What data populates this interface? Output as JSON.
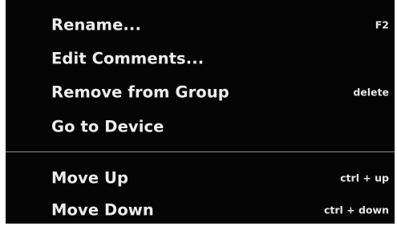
{
  "context_menu": {
    "items": [
      {
        "label": "Rename...",
        "shortcut": "F2"
      },
      {
        "label": "Edit Comments...",
        "shortcut": ""
      },
      {
        "label": "Remove from Group",
        "shortcut": "delete"
      },
      {
        "label": "Go to Device",
        "shortcut": ""
      },
      {
        "label": "Move Up",
        "shortcut": "ctrl + up"
      },
      {
        "label": "Move Down",
        "shortcut": "ctrl + down"
      }
    ]
  },
  "colors": {
    "menu_background": "#050505",
    "text": "#ededed",
    "separator": "#8a8a8a"
  }
}
